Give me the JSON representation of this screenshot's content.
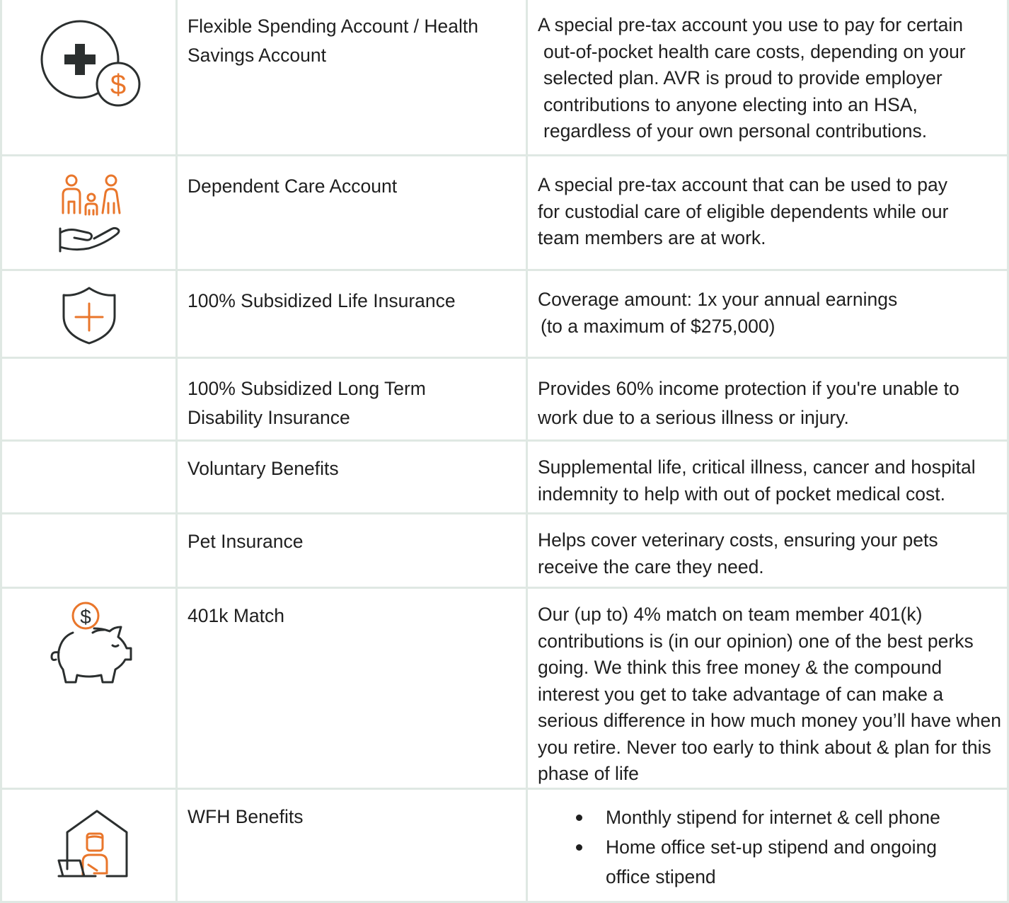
{
  "colors": {
    "accent": "#e9762b",
    "icon_stroke": "#2b2f2f",
    "grid": "#dfe8e3",
    "text": "#1f1f1f"
  },
  "rows": [
    {
      "icon": "health-plus-dollar-icon",
      "name_lines": [
        "Flexible Spending Account / Health",
        "Savings Account"
      ],
      "desc_lines": [
        "A special pre-tax account you use to pay for certain",
        "out-of-pocket health care costs, depending on your",
        "selected plan. AVR is proud to provide employer",
        "contributions to anyone electing into an HSA,",
        "regardless of your own personal contributions."
      ],
      "price_symbol": "$"
    },
    {
      "icon": "family-hand-icon",
      "name_lines": [
        "Dependent Care Account"
      ],
      "desc_lines": [
        "A special pre-tax account that can be used to pay",
        "for custodial care of eligible dependents while our",
        "team members are at work."
      ]
    },
    {
      "icon": "shield-plus-icon",
      "name_lines": [
        "100% Subsidized Life Insurance"
      ],
      "desc_lines": [
        "Coverage amount: 1x your annual earnings",
        "(to a maximum of $275,000)"
      ]
    },
    {
      "icon": "",
      "name_lines": [
        "100% Subsidized Long Term",
        "Disability Insurance"
      ],
      "desc_lines": [
        "Provides 60% income protection if you're unable to",
        "work due to a serious illness or injury."
      ]
    },
    {
      "icon": "",
      "name_lines": [
        "Voluntary Benefits"
      ],
      "desc_lines": [
        "Supplemental life, critical illness, cancer and hospital",
        "indemnity to help with out of pocket medical cost."
      ]
    },
    {
      "icon": "",
      "name_lines": [
        "Pet Insurance"
      ],
      "desc_lines": [
        "Helps cover veterinary costs, ensuring your pets",
        "receive the care they need."
      ]
    },
    {
      "icon": "piggy-bank-icon",
      "name_lines": [
        "401k Match"
      ],
      "desc_lines": [
        "Our (up to) 4% match on team member 401(k)",
        "contributions is (in our opinion) one of the best perks",
        "going. We think this free money & the compound",
        "interest you get to take advantage of can make a",
        "serious difference in how much money you’ll have when",
        "you retire. Never too early to think about & plan for this",
        "phase of life"
      ],
      "price_symbol": "$"
    },
    {
      "icon": "home-office-icon",
      "name_lines": [
        "WFH Benefits"
      ],
      "bullets": [
        {
          "lines": [
            "Monthly stipend for internet & cell phone"
          ]
        },
        {
          "lines": [
            "Home office set-up stipend and ongoing",
            "office stipend"
          ]
        }
      ]
    }
  ]
}
